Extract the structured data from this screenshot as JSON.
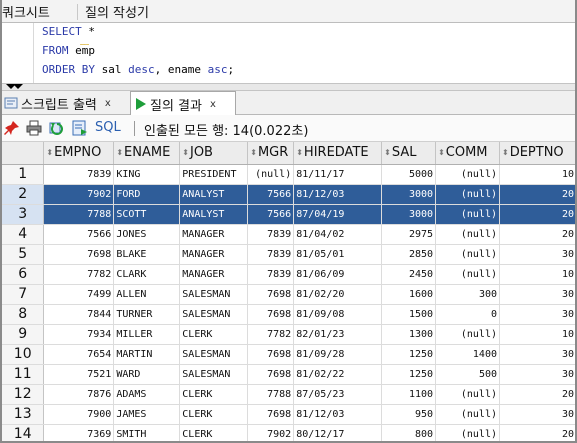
{
  "top_tabs": [
    "쿼크시트",
    "질의 작성기"
  ],
  "editor": {
    "line1_kw": "SELECT",
    "line1_rest": " *",
    "line2_kw": "FROM",
    "line2_rest": " emp",
    "line3_kw1": "ORDER BY",
    "line3_mid1": " sal ",
    "line3_kw2": "desc",
    "line3_mid2": ", ename ",
    "line3_kw3": "asc",
    "line3_end": ";"
  },
  "result_tabs": [
    {
      "label": "스크립트 출력",
      "close": "x"
    },
    {
      "label": "질의 결과",
      "close": "x"
    }
  ],
  "toolbar": {
    "sql_label": "SQL",
    "status": "인출된 모든 행: 14(0.022초)"
  },
  "colors": {
    "selection": "#2f5d99",
    "keyword": "#2b3aa8",
    "run_icon": "#1e9e3a"
  },
  "grid": {
    "columns": [
      "EMPNO",
      "ENAME",
      "JOB",
      "MGR",
      "HIREDATE",
      "SAL",
      "COMM",
      "DEPTNO"
    ],
    "selected_rows": [
      2,
      3
    ],
    "rows": [
      [
        "1",
        "7839",
        "KING",
        "PRESIDENT",
        "(null)",
        "81/11/17",
        "5000",
        "(null)",
        "10"
      ],
      [
        "2",
        "7902",
        "FORD",
        "ANALYST",
        "7566",
        "81/12/03",
        "3000",
        "(null)",
        "20"
      ],
      [
        "3",
        "7788",
        "SCOTT",
        "ANALYST",
        "7566",
        "87/04/19",
        "3000",
        "(null)",
        "20"
      ],
      [
        "4",
        "7566",
        "JONES",
        "MANAGER",
        "7839",
        "81/04/02",
        "2975",
        "(null)",
        "20"
      ],
      [
        "5",
        "7698",
        "BLAKE",
        "MANAGER",
        "7839",
        "81/05/01",
        "2850",
        "(null)",
        "30"
      ],
      [
        "6",
        "7782",
        "CLARK",
        "MANAGER",
        "7839",
        "81/06/09",
        "2450",
        "(null)",
        "10"
      ],
      [
        "7",
        "7499",
        "ALLEN",
        "SALESMAN",
        "7698",
        "81/02/20",
        "1600",
        "300",
        "30"
      ],
      [
        "8",
        "7844",
        "TURNER",
        "SALESMAN",
        "7698",
        "81/09/08",
        "1500",
        "0",
        "30"
      ],
      [
        "9",
        "7934",
        "MILLER",
        "CLERK",
        "7782",
        "82/01/23",
        "1300",
        "(null)",
        "10"
      ],
      [
        "10",
        "7654",
        "MARTIN",
        "SALESMAN",
        "7698",
        "81/09/28",
        "1250",
        "1400",
        "30"
      ],
      [
        "11",
        "7521",
        "WARD",
        "SALESMAN",
        "7698",
        "81/02/22",
        "1250",
        "500",
        "30"
      ],
      [
        "12",
        "7876",
        "ADAMS",
        "CLERK",
        "7788",
        "87/05/23",
        "1100",
        "(null)",
        "20"
      ],
      [
        "13",
        "7900",
        "JAMES",
        "CLERK",
        "7698",
        "81/12/03",
        "950",
        "(null)",
        "30"
      ],
      [
        "14",
        "7369",
        "SMITH",
        "CLERK",
        "7902",
        "80/12/17",
        "800",
        "(null)",
        "20"
      ]
    ]
  }
}
